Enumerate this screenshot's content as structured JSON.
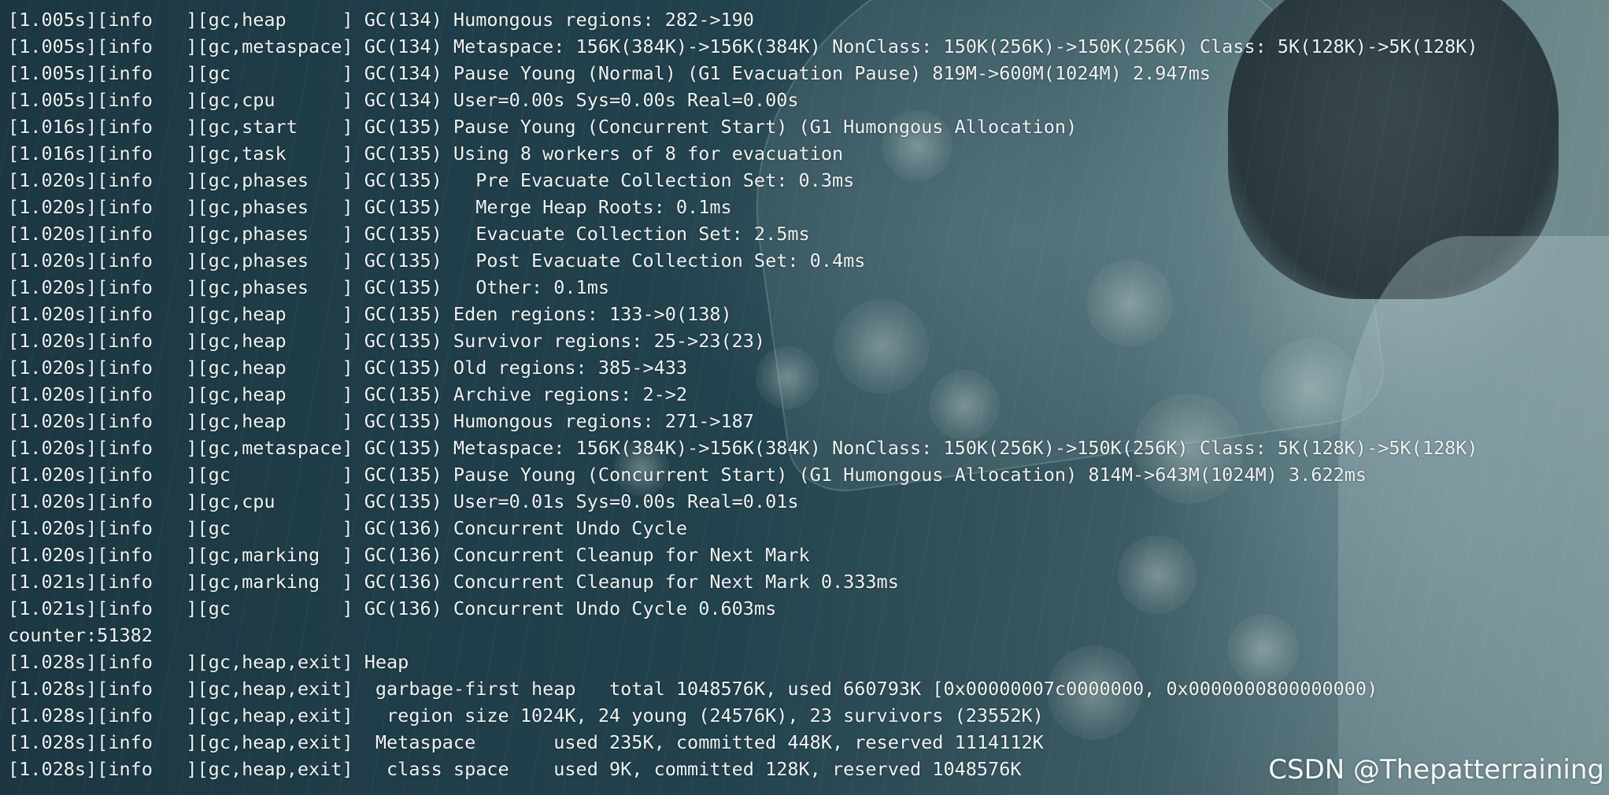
{
  "terminal": {
    "lines": [
      "[1.005s][info   ][gc,heap     ] GC(134) Humongous regions: 282->190",
      "[1.005s][info   ][gc,metaspace] GC(134) Metaspace: 156K(384K)->156K(384K) NonClass: 150K(256K)->150K(256K) Class: 5K(128K)->5K(128K)",
      "[1.005s][info   ][gc          ] GC(134) Pause Young (Normal) (G1 Evacuation Pause) 819M->600M(1024M) 2.947ms",
      "[1.005s][info   ][gc,cpu      ] GC(134) User=0.00s Sys=0.00s Real=0.00s",
      "[1.016s][info   ][gc,start    ] GC(135) Pause Young (Concurrent Start) (G1 Humongous Allocation)",
      "[1.016s][info   ][gc,task     ] GC(135) Using 8 workers of 8 for evacuation",
      "[1.020s][info   ][gc,phases   ] GC(135)   Pre Evacuate Collection Set: 0.3ms",
      "[1.020s][info   ][gc,phases   ] GC(135)   Merge Heap Roots: 0.1ms",
      "[1.020s][info   ][gc,phases   ] GC(135)   Evacuate Collection Set: 2.5ms",
      "[1.020s][info   ][gc,phases   ] GC(135)   Post Evacuate Collection Set: 0.4ms",
      "[1.020s][info   ][gc,phases   ] GC(135)   Other: 0.1ms",
      "[1.020s][info   ][gc,heap     ] GC(135) Eden regions: 133->0(138)",
      "[1.020s][info   ][gc,heap     ] GC(135) Survivor regions: 25->23(23)",
      "[1.020s][info   ][gc,heap     ] GC(135) Old regions: 385->433",
      "[1.020s][info   ][gc,heap     ] GC(135) Archive regions: 2->2",
      "[1.020s][info   ][gc,heap     ] GC(135) Humongous regions: 271->187",
      "[1.020s][info   ][gc,metaspace] GC(135) Metaspace: 156K(384K)->156K(384K) NonClass: 150K(256K)->150K(256K) Class: 5K(128K)->5K(128K)",
      "[1.020s][info   ][gc          ] GC(135) Pause Young (Concurrent Start) (G1 Humongous Allocation) 814M->643M(1024M) 3.622ms",
      "[1.020s][info   ][gc,cpu      ] GC(135) User=0.01s Sys=0.00s Real=0.01s",
      "[1.020s][info   ][gc          ] GC(136) Concurrent Undo Cycle",
      "[1.020s][info   ][gc,marking  ] GC(136) Concurrent Cleanup for Next Mark",
      "[1.021s][info   ][gc,marking  ] GC(136) Concurrent Cleanup for Next Mark 0.333ms",
      "[1.021s][info   ][gc          ] GC(136) Concurrent Undo Cycle 0.603ms",
      "counter:51382",
      "[1.028s][info   ][gc,heap,exit] Heap",
      "[1.028s][info   ][gc,heap,exit]  garbage-first heap   total 1048576K, used 660793K [0x00000007c0000000, 0x0000000800000000)",
      "[1.028s][info   ][gc,heap,exit]   region size 1024K, 24 young (24576K), 23 survivors (23552K)",
      "[1.028s][info   ][gc,heap,exit]  Metaspace       used 235K, committed 448K, reserved 1114112K",
      "[1.028s][info   ][gc,heap,exit]   class space    used 9K, committed 128K, reserved 1048576K"
    ]
  },
  "watermark": "CSDN @Thepatterraining"
}
